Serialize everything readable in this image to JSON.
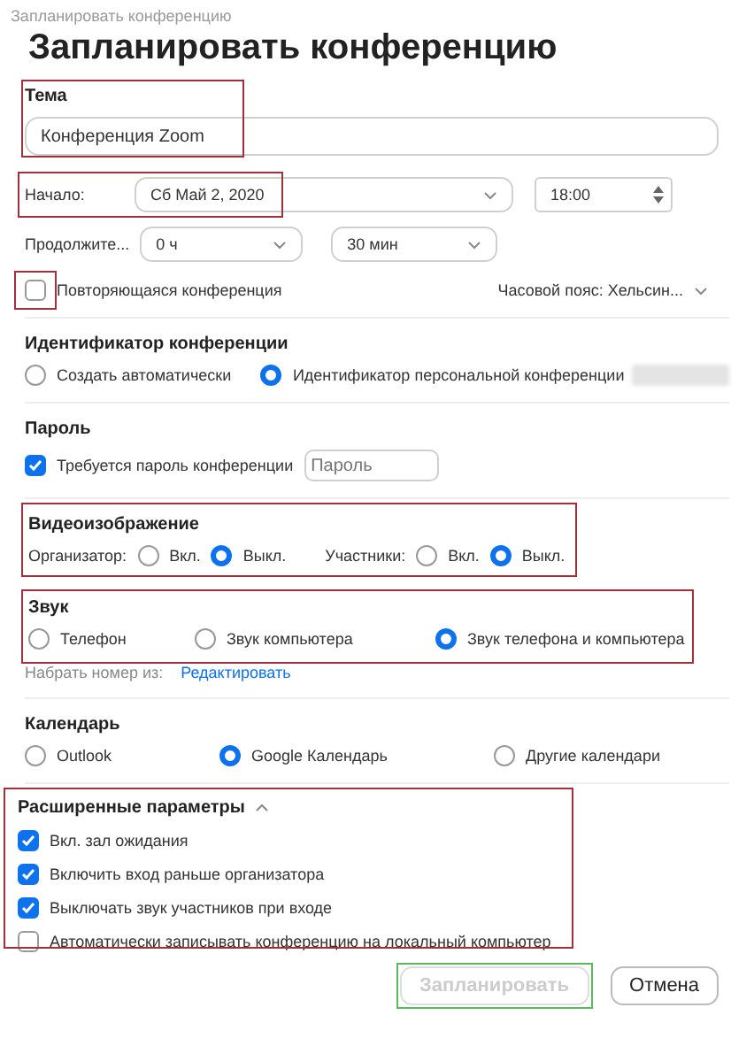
{
  "window": {
    "title": "Запланировать конференцию"
  },
  "heading": "Запланировать конференцию",
  "topic": {
    "label": "Тема",
    "value": "Конференция Zoom",
    "highlighted": true
  },
  "start": {
    "label": "Начало:",
    "date": "Сб  Май 2, 2020",
    "time": "18:00",
    "highlighted": true
  },
  "duration": {
    "label": "Продолжите...",
    "hours": "0 ч",
    "minutes": "30 мин"
  },
  "recurring": {
    "label": "Повторяющаяся конференция",
    "checked": false,
    "highlighted": true
  },
  "timezone": "Часовой пояс: Хельсин...",
  "meeting_id": {
    "title": "Идентификатор конференции",
    "options": [
      {
        "label": "Создать автоматически",
        "selected": false
      },
      {
        "label": "Идентификатор персональной конференции",
        "selected": true
      }
    ]
  },
  "password": {
    "title": "Пароль",
    "label": "Требуется пароль конференции",
    "checked": true,
    "placeholder": "Пароль"
  },
  "video": {
    "title": "Видеоизображение",
    "highlighted": true,
    "groups": [
      {
        "label": "Организатор:",
        "options": [
          {
            "label": "Вкл.",
            "selected": false
          },
          {
            "label": "Выкл.",
            "selected": true
          }
        ]
      },
      {
        "label": "Участники:",
        "options": [
          {
            "label": "Вкл.",
            "selected": false
          },
          {
            "label": "Выкл.",
            "selected": true
          }
        ]
      }
    ]
  },
  "audio": {
    "title": "Звук",
    "highlighted": true,
    "options": [
      {
        "label": "Телефон",
        "selected": false
      },
      {
        "label": "Звук компьютера",
        "selected": false
      },
      {
        "label": "Звук телефона и компьютера",
        "selected": true
      }
    ],
    "dial_label": "Набрать номер из:",
    "edit_link": "Редактировать"
  },
  "calendar": {
    "title": "Календарь",
    "options": [
      {
        "label": "Outlook",
        "selected": false
      },
      {
        "label": "Google Календарь",
        "selected": true
      },
      {
        "label": "Другие календари",
        "selected": false
      }
    ]
  },
  "advanced": {
    "title": "Расширенные параметры",
    "expanded": true,
    "highlighted": true,
    "options": [
      {
        "label": "Вкл. зал ожидания",
        "checked": true
      },
      {
        "label": "Включить вход раньше организатора",
        "checked": true
      },
      {
        "label": "Выключать звук участников при входе",
        "checked": true
      },
      {
        "label": "Автоматически записывать конференцию на локальный компьютер",
        "checked": false
      }
    ]
  },
  "buttons": [
    {
      "label": "Запланировать",
      "disabled": true,
      "highlighted": true
    },
    {
      "label": "Отмена",
      "disabled": false,
      "highlighted": false
    }
  ]
}
